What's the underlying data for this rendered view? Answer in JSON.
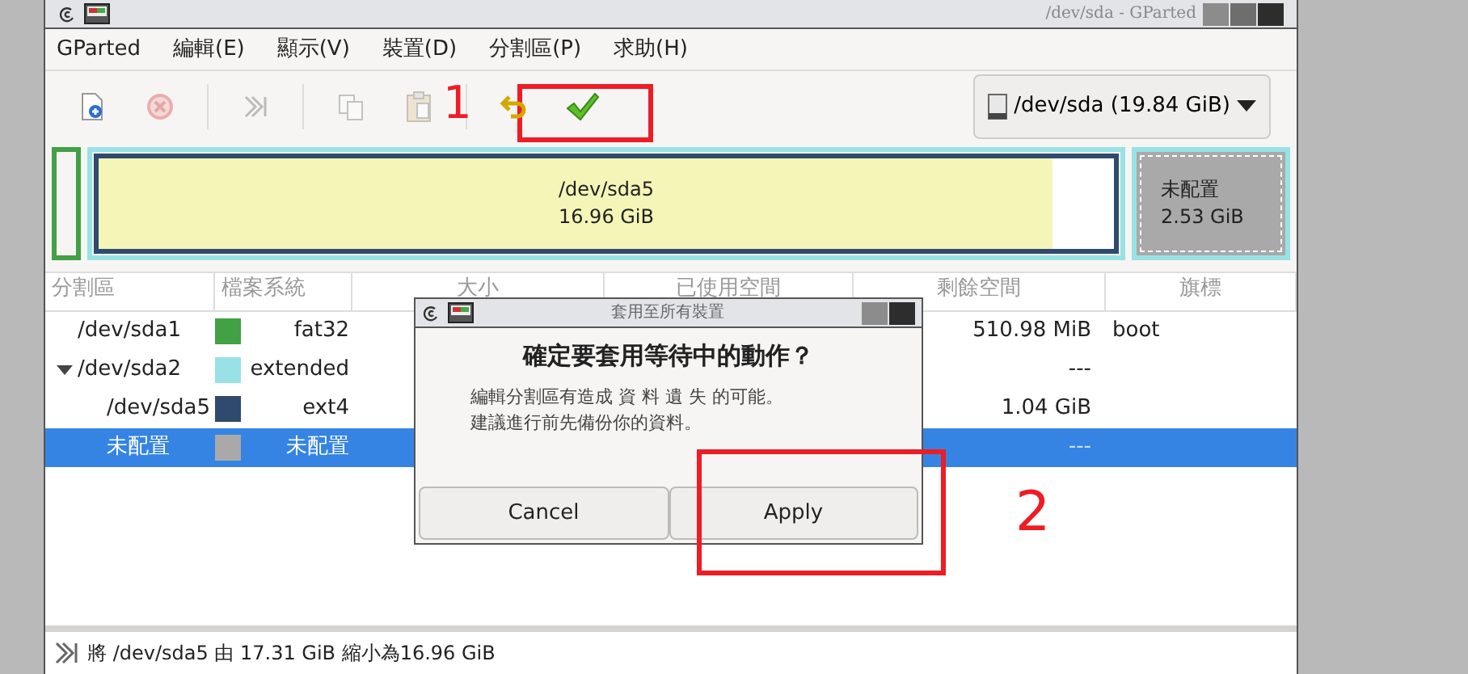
{
  "window": {
    "title": "/dev/sda - GParted"
  },
  "menu": [
    "GParted",
    "編輯(E)",
    "顯示(V)",
    "裝置(D)",
    "分割區(P)",
    "求助(H)"
  ],
  "toolbar": [
    {
      "kind": "new",
      "disabled": false
    },
    {
      "kind": "delete",
      "disabled": true
    },
    {
      "kind": "resize",
      "disabled": true
    },
    {
      "kind": "copy",
      "disabled": true
    },
    {
      "kind": "paste",
      "disabled": true
    },
    {
      "kind": "undo",
      "disabled": false
    },
    {
      "kind": "apply",
      "disabled": false
    }
  ],
  "device_selector": {
    "label": "/dev/sda (19.84 GiB)"
  },
  "partition_map": {
    "first": {
      "color": "#42a045"
    },
    "extended": {
      "color": "#98e2e6"
    },
    "logical": {
      "name": "/dev/sda5",
      "size": "16.96 GiB",
      "color": "#2f4a6c",
      "level": 0.94
    },
    "unallocated": {
      "name": "未配置",
      "size": "2.53 GiB"
    }
  },
  "table": {
    "columns": [
      "分割區",
      "檔案系統",
      "大小",
      "已使用空間",
      "剩餘空間",
      "旗標"
    ],
    "rows": [
      {
        "partition": "/dev/sda1",
        "filesystem": "fat32",
        "color": "#42a045",
        "unused": "510.98 MiB",
        "flags": "boot",
        "selected": false
      },
      {
        "partition": "/dev/sda2",
        "filesystem": "extended",
        "color": "#98e2e6",
        "unused": "---",
        "selected": false,
        "expanded": true,
        "children": [
          {
            "partition": "/dev/sda5",
            "filesystem": "ext4",
            "color": "#2f4a6c",
            "unused": "1.04 GiB",
            "selected": false
          },
          {
            "partition": "未配置",
            "filesystem": "未配置",
            "color": "#a9a9a9",
            "unused": "---",
            "selected": true
          }
        ]
      }
    ]
  },
  "dialog": {
    "title": "套用至所有裝置",
    "heading": "確定要套用等待中的動作？",
    "body": [
      "編輯分割區有造成 資 料 遺 失 的可能。",
      "建議進行前先備份你的資料。"
    ],
    "buttons": [
      "Cancel",
      "Apply"
    ]
  },
  "status_bar": {
    "text": "將 /dev/sda5 由 17.31 GiB 縮小為16.96 GiB"
  },
  "annotations": [
    "1",
    "2"
  ]
}
